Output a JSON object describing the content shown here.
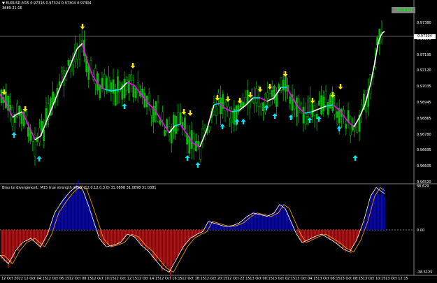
{
  "header": {
    "symbol_line": "▼ EURUSD,M15  0.97316 0.97324 0.97304 0.97304",
    "info_line": "3889  21:16"
  },
  "legend_button": "[bfrmle]",
  "price_badge": "0.97304",
  "indicator_title": "Blau tsi divergence1: M15 true strength index (12.0.12.0,3.0) 31.0898 31.0898 31.0381",
  "price_axis_labels": [
    "0.97380",
    "0.97270",
    "0.97195",
    "0.97120",
    "0.97035",
    "0.96945",
    "0.96865",
    "0.96780",
    "0.96695",
    "0.96605",
    "0.96520"
  ],
  "indicator_axis_labels": [
    "38.629",
    "0.00",
    "-38.5125"
  ],
  "time_labels": [
    "12 Oct 2022",
    "12 Oct 04:15",
    "12 Oct 06:15",
    "12 Oct 08:15",
    "12 Oct 10:15",
    "12 Oct 12:15",
    "12 Oct 14:15",
    "12 Oct 16:15",
    "12 Oct 18:15",
    "12 Oct 20:15",
    "12 Oct 22:15",
    "13 Oct 00:15",
    "13 Oct 02:15",
    "13 Oct 04:15",
    "13 Oct 06:15",
    "13 Oct 08:15",
    "13 Oct 10:15",
    "13 Oct 12:15"
  ],
  "colors": {
    "background": "#000000",
    "candle": "#00c000",
    "candle_up_body": "#000000",
    "ma_up": "#ffffff",
    "ma_down": "#ff00ff",
    "ma_cyan": "#00e5ff",
    "arrow_up": "#00e5ff",
    "arrow_down": "#ffe600",
    "hist_pos": "#0000e6",
    "hist_neg": "#e60000",
    "tsi_line": "#ffffff",
    "signal_line": "#ffa500"
  }
}
